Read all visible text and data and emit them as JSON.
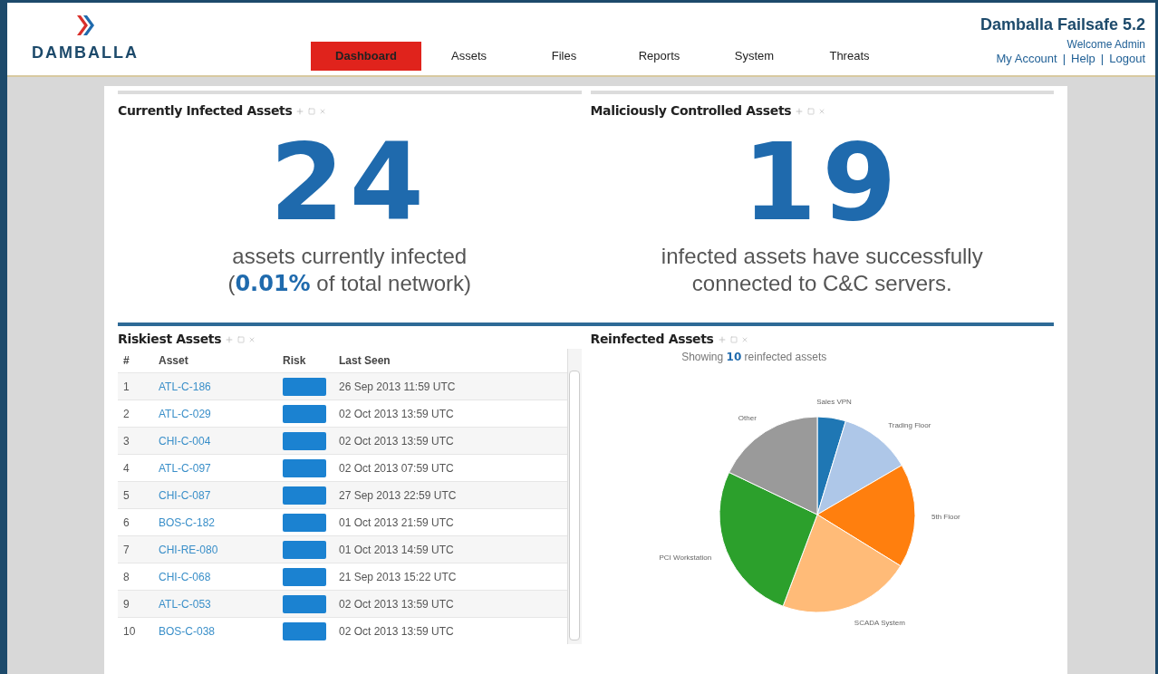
{
  "header": {
    "brand": "DAMBALLA",
    "product": "Damballa Failsafe 5.2",
    "welcome": "Welcome Admin",
    "links": [
      "My Account",
      "Help",
      "Logout"
    ],
    "separators": [
      "|",
      "|"
    ]
  },
  "nav": [
    {
      "label": "Dashboard",
      "selected": true
    },
    {
      "label": "Assets",
      "selected": false
    },
    {
      "label": "Files",
      "selected": false
    },
    {
      "label": "Reports",
      "selected": false
    },
    {
      "label": "System",
      "selected": false
    },
    {
      "label": "Threats",
      "selected": false
    }
  ],
  "infected": {
    "title": "Currently Infected Assets",
    "count": "24",
    "line1": "assets currently infected",
    "line2": "(**0.01%** of total network)"
  },
  "controlled": {
    "title": "Maliciously Controlled Assets",
    "count": "19",
    "line1": "infected assets have successfully",
    "line2": "connected to C&C servers."
  },
  "riskiest": {
    "title": "Riskiest Assets",
    "columns": [
      "#",
      "Asset",
      "Risk",
      "Last Seen"
    ],
    "rows": [
      {
        "index": "1",
        "asset": "ATL-C-186",
        "last_seen": "26 Sep 2013 11:59 UTC"
      },
      {
        "index": "2",
        "asset": "ATL-C-029",
        "last_seen": "02 Oct 2013 13:59 UTC"
      },
      {
        "index": "3",
        "asset": "CHI-C-004",
        "last_seen": "02 Oct 2013 13:59 UTC"
      },
      {
        "index": "4",
        "asset": "ATL-C-097",
        "last_seen": "02 Oct 2013 07:59 UTC"
      },
      {
        "index": "5",
        "asset": "CHI-C-087",
        "last_seen": "27 Sep 2013 22:59 UTC"
      },
      {
        "index": "6",
        "asset": "BOS-C-182",
        "last_seen": "01 Oct 2013 21:59 UTC"
      },
      {
        "index": "7",
        "asset": "CHI-RE-080",
        "last_seen": "01 Oct 2013 14:59 UTC"
      },
      {
        "index": "8",
        "asset": "CHI-C-068",
        "last_seen": "21 Sep 2013 15:22 UTC"
      },
      {
        "index": "9",
        "asset": "ATL-C-053",
        "last_seen": "02 Oct 2013 13:59 UTC"
      },
      {
        "index": "10",
        "asset": "BOS-C-038",
        "last_seen": "02 Oct 2013 13:59 UTC"
      }
    ]
  },
  "reinfected": {
    "title": "Reinfected Assets",
    "caption": "Showing **10** reinfected assets",
    "chart_data": {
      "type": "pie",
      "categories": [
        "Sales VPN",
        "Trading Floor",
        "5th Floor",
        "SCADA System",
        "PCI Workstation",
        "Other"
      ],
      "series": [
        {
          "values": [
            4.7,
            11.9,
            17.2,
            21.9,
            26.4,
            17.9
          ]
        }
      ],
      "colors": [
        "#1f77b4",
        "#aec7e8",
        "#ff7f0e",
        "#ffbb78",
        "#2ca02c",
        "#9a9a9a"
      ]
    }
  }
}
